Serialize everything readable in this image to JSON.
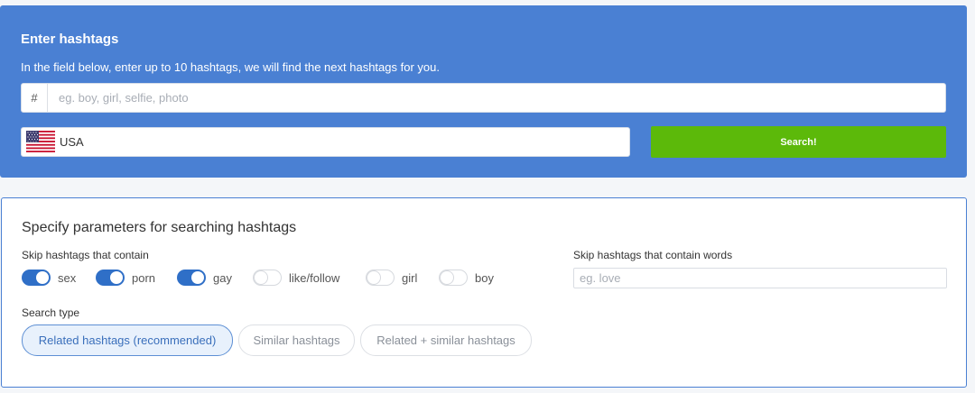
{
  "header": {
    "title": "Enter hashtags",
    "subtitle": "In the field below, enter up to 10 hashtags, we will find the next hashtags for you."
  },
  "hashtag_input": {
    "prefix": "#",
    "placeholder": "eg. boy, girl, selfie, photo",
    "value": ""
  },
  "country": {
    "label": "USA",
    "flag_icon": "us-flag-icon"
  },
  "search_button": {
    "label": "Search!"
  },
  "params": {
    "title": "Specify parameters for searching hashtags",
    "skip_label": "Skip hashtags that contain",
    "toggles": [
      {
        "label": "sex",
        "on": true
      },
      {
        "label": "porn",
        "on": true
      },
      {
        "label": "gay",
        "on": true
      },
      {
        "label": "like/follow",
        "on": false
      },
      {
        "label": "girl",
        "on": false
      },
      {
        "label": "boy",
        "on": false
      }
    ],
    "words_label": "Skip hashtags that contain words",
    "words_placeholder": "eg. love",
    "search_type_label": "Search type",
    "search_types": [
      {
        "label": "Related hashtags (recommended)",
        "active": true
      },
      {
        "label": "Similar hashtags",
        "active": false
      },
      {
        "label": "Related + similar hashtags",
        "active": false
      }
    ]
  },
  "colors": {
    "header_bg": "#4a80d3",
    "search_button": "#5cb90a",
    "toggle_on": "#2f6fc7"
  }
}
